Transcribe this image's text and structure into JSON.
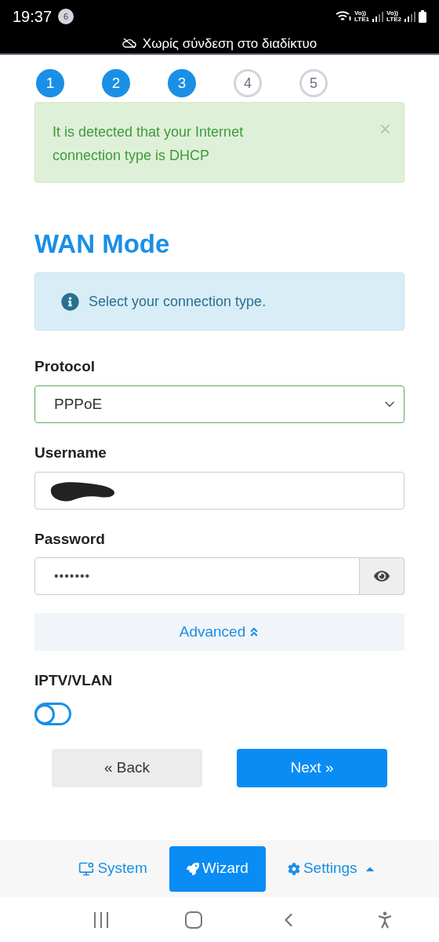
{
  "status_bar": {
    "time": "19:37",
    "notification_count": "6",
    "sims": [
      {
        "top": "Vo))",
        "bottom": "LTE1"
      },
      {
        "top": "Vo))",
        "bottom": "LTE2"
      }
    ],
    "offline_text": "Χωρίς σύνδεση στο διαδίκτυο"
  },
  "steps": [
    {
      "label": "1",
      "done": true
    },
    {
      "label": "2",
      "done": true
    },
    {
      "label": "3",
      "done": true
    },
    {
      "label": "4",
      "done": false
    },
    {
      "label": "5",
      "done": false
    }
  ],
  "alert": {
    "text": "It is detected that your Internet connection type is DHCP",
    "close": "×"
  },
  "title": "WAN Mode",
  "info": "Select your connection type.",
  "form": {
    "protocol": {
      "label": "Protocol",
      "value": "PPPoE"
    },
    "username": {
      "label": "Username",
      "redacted": true
    },
    "password": {
      "label": "Password",
      "value": "•••••••"
    },
    "advanced": {
      "label": "Advanced",
      "expanded": true
    },
    "iptv": {
      "label": "IPTV/VLAN",
      "on": false
    }
  },
  "buttons": [
    {
      "label": "« Back",
      "kind": "secondary"
    },
    {
      "label": "Next »",
      "kind": "primary"
    }
  ],
  "nav": [
    {
      "label": "System",
      "selected": false
    },
    {
      "label": "Wizard",
      "selected": true
    },
    {
      "label": "Settings",
      "selected": false,
      "caret": true
    }
  ]
}
